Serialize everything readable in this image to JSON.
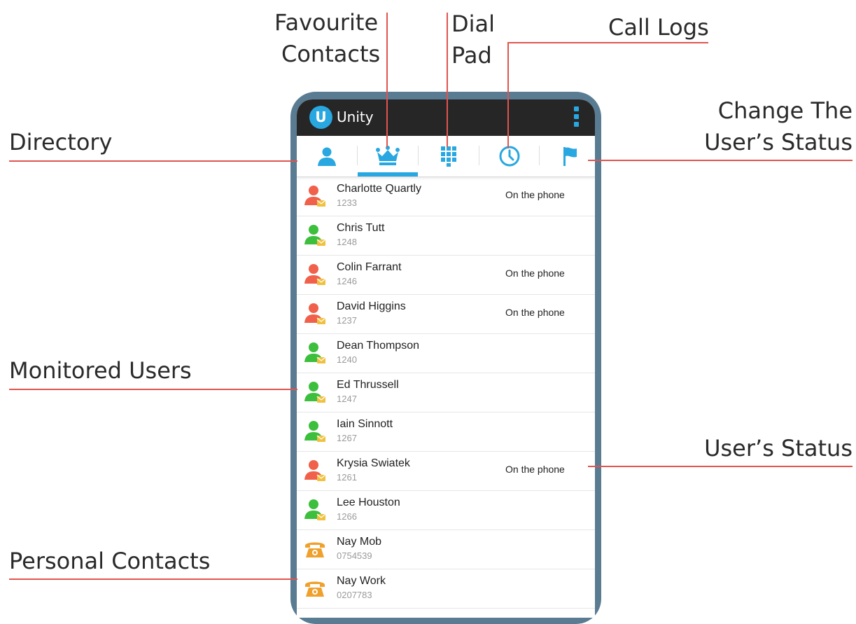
{
  "callouts": {
    "favourite_contacts": [
      "Favourite",
      "Contacts"
    ],
    "dial_pad": [
      "Dial",
      "Pad"
    ],
    "call_logs": "Call Logs",
    "change_status": [
      "Change The",
      "User’s Status"
    ],
    "directory": "Directory",
    "monitored_users": "Monitored Users",
    "users_status": "User’s Status",
    "personal_contacts": "Personal Contacts"
  },
  "app": {
    "logo_letter": "U",
    "title": "Unity",
    "menu_icon": "kebab-menu-icon",
    "accent": "#29a7e0",
    "appbar_color": "#262626"
  },
  "tabs": [
    {
      "name": "directory",
      "icon": "person-icon"
    },
    {
      "name": "favourites",
      "icon": "crown-icon",
      "selected": true
    },
    {
      "name": "dial-pad",
      "icon": "dialpad-icon"
    },
    {
      "name": "call-logs",
      "icon": "clock-icon"
    },
    {
      "name": "status",
      "icon": "flag-icon"
    }
  ],
  "colors": {
    "busy": "#f0604a",
    "available": "#3cbf3c",
    "personal": "#f0a02c",
    "callout_line": "#e0544f"
  },
  "contacts": [
    {
      "name": "Charlotte Quartly",
      "ext": "1233",
      "status": "On the phone",
      "type": "busy"
    },
    {
      "name": "Chris Tutt",
      "ext": "1248",
      "status": "",
      "type": "available"
    },
    {
      "name": "Colin Farrant",
      "ext": "1246",
      "status": "On the phone",
      "type": "busy"
    },
    {
      "name": "David Higgins",
      "ext": "1237",
      "status": "On the phone",
      "type": "busy"
    },
    {
      "name": "Dean Thompson",
      "ext": "1240",
      "status": "",
      "type": "available"
    },
    {
      "name": "Ed Thrussell",
      "ext": "1247",
      "status": "",
      "type": "available"
    },
    {
      "name": "Iain Sinnott",
      "ext": "1267",
      "status": "",
      "type": "available"
    },
    {
      "name": "Krysia Swiatek",
      "ext": "1261",
      "status": "On the phone",
      "type": "busy"
    },
    {
      "name": "Lee Houston",
      "ext": "1266",
      "status": "",
      "type": "available"
    },
    {
      "name": "Nay Mob",
      "ext": "0754539",
      "status": "",
      "type": "personal"
    },
    {
      "name": "Nay Work",
      "ext": "0207783",
      "status": "",
      "type": "personal"
    }
  ]
}
